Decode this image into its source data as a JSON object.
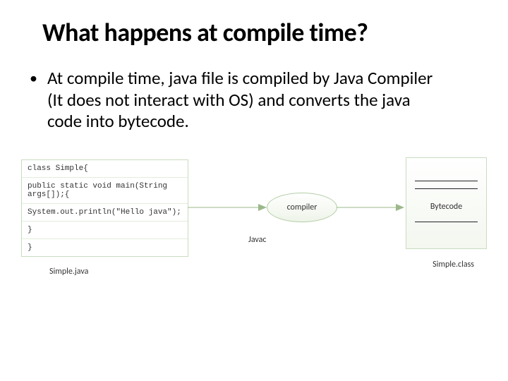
{
  "title": "What happens at compile time?",
  "bullet": "At compile time, java file is compiled by Java Compiler (It does not interact with OS) and converts the java code into bytecode.",
  "code": {
    "l0": "class Simple{",
    "l1": "public  static void main(String args[]);{",
    "l2": "System.out.println(\"Hello java\");",
    "l3": "}",
    "l4": "}"
  },
  "diagram": {
    "javac_label": "Javac",
    "compiler_label": "compiler",
    "bytecode_label": "Bytecode",
    "source_caption": "Simple.java",
    "output_caption": "Simple.class"
  }
}
